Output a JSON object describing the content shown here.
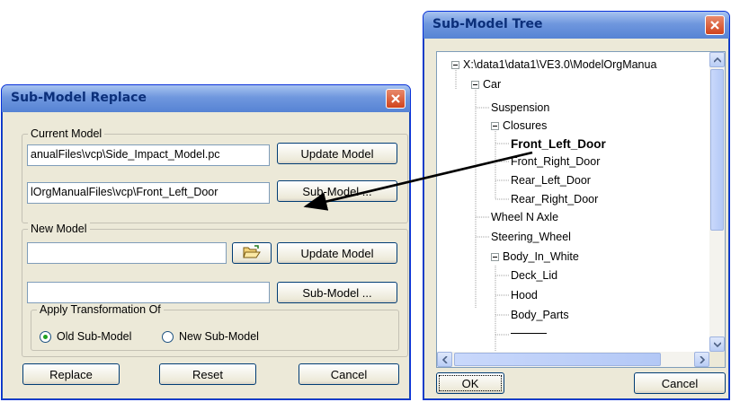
{
  "replace_dialog": {
    "title": "Sub-Model Replace",
    "current_model": {
      "legend": "Current Model",
      "path_top": "anualFiles\\vcp\\Side_Impact_Model.pc",
      "path_bottom": "lOrgManualFiles\\vcp\\Front_Left_Door",
      "update_button": "Update Model",
      "submodel_button": "Sub-Model ..."
    },
    "new_model": {
      "legend": "New Model",
      "path_top": "",
      "path_bottom": "",
      "browse_icon": "folder-open-icon",
      "update_button": "Update Model",
      "submodel_button": "Sub-Model ..."
    },
    "transform": {
      "legend": "Apply Transformation Of",
      "options": [
        {
          "label": "Old Sub-Model",
          "selected": true
        },
        {
          "label": "New Sub-Model",
          "selected": false
        }
      ]
    },
    "footer": {
      "replace": "Replace",
      "reset": "Reset",
      "cancel": "Cancel"
    }
  },
  "tree_dialog": {
    "title": "Sub-Model Tree",
    "nodes": [
      {
        "label": "X:\\data1\\data1\\VE3.0\\ModelOrgManua",
        "depth": 0,
        "expander": true
      },
      {
        "label": "Car",
        "depth": 1,
        "expander": true
      },
      {
        "label": "Suspension",
        "depth": 2,
        "expander": false
      },
      {
        "label": "Closures",
        "depth": 2,
        "expander": true
      },
      {
        "label": "Front_Left_Door",
        "depth": 3,
        "expander": false,
        "bold": true
      },
      {
        "label": "Front_Right_Door",
        "depth": 3,
        "expander": false
      },
      {
        "label": "Rear_Left_Door",
        "depth": 3,
        "expander": false
      },
      {
        "label": "Rear_Right_Door",
        "depth": 3,
        "expander": false
      },
      {
        "label": "Wheel N Axle",
        "depth": 2,
        "expander": false
      },
      {
        "label": "Steering_Wheel",
        "depth": 2,
        "expander": false
      },
      {
        "label": "Body_In_White",
        "depth": 2,
        "expander": true
      },
      {
        "label": "Deck_Lid",
        "depth": 3,
        "expander": false
      },
      {
        "label": "Hood",
        "depth": 3,
        "expander": false
      },
      {
        "label": "Body_Parts",
        "depth": 3,
        "expander": false
      }
    ],
    "ok": "OK",
    "cancel": "Cancel"
  },
  "colors": {
    "window_bg": "#ece9d8",
    "title_bar": "#6f97de",
    "title_text": "#0b2f7a",
    "close_button": "#d0431d",
    "arrow": "#000000"
  }
}
